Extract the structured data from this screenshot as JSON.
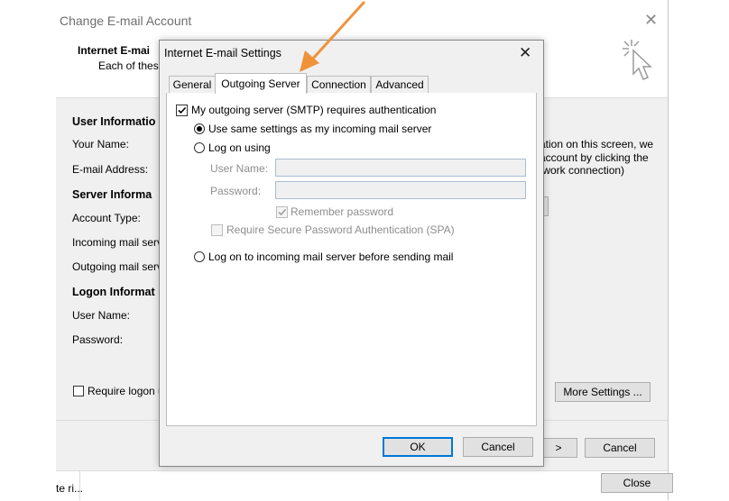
{
  "background_window": {
    "title": "Change E-mail Account",
    "header_title": "Internet E-mai",
    "header_subtitle": "Each of thes",
    "sections": {
      "user_info": "User Informatio",
      "server_info": "Server Informa",
      "logon_info": "Logon Informat"
    },
    "labels": {
      "your_name": "Your Name:",
      "email_address": "E-mail Address:",
      "account_type": "Account Type:",
      "incoming_server": "Incoming mail serv",
      "outgoing_server": "Outgoing mail serv",
      "user_name": "User Name:",
      "password": "Password:"
    },
    "require_logon_label": "Require logon u",
    "right_text_lines": [
      "ation on this screen, we",
      "account by clicking the",
      "twork connection)"
    ],
    "more_settings_label": "More Settings ...",
    "next_label": ">",
    "cancel_label": "Cancel",
    "close_label": "Close",
    "status_text": "te ri..."
  },
  "dialog": {
    "title": "Internet E-mail Settings",
    "tabs": [
      {
        "label": "General",
        "active": false
      },
      {
        "label": "Outgoing Server",
        "active": true
      },
      {
        "label": "Connection",
        "active": false
      },
      {
        "label": "Advanced",
        "active": false
      }
    ],
    "smtp_auth_label": "My outgoing server (SMTP) requires authentication",
    "smtp_auth_checked": true,
    "use_same_settings_label": "Use same settings as my incoming mail server",
    "log_on_using_label": "Log on using",
    "user_name_label": "User Name:",
    "user_name_value": "",
    "password_label": "Password:",
    "password_value": "",
    "remember_password_label": "Remember password",
    "spa_label": "Require Secure Password Authentication (SPA)",
    "log_on_before_send_label": "Log on to incoming mail server before sending mail",
    "ok_label": "OK",
    "cancel_label": "Cancel"
  },
  "colors": {
    "annotation_arrow": "#f0923a",
    "accent": "#0078d7"
  }
}
